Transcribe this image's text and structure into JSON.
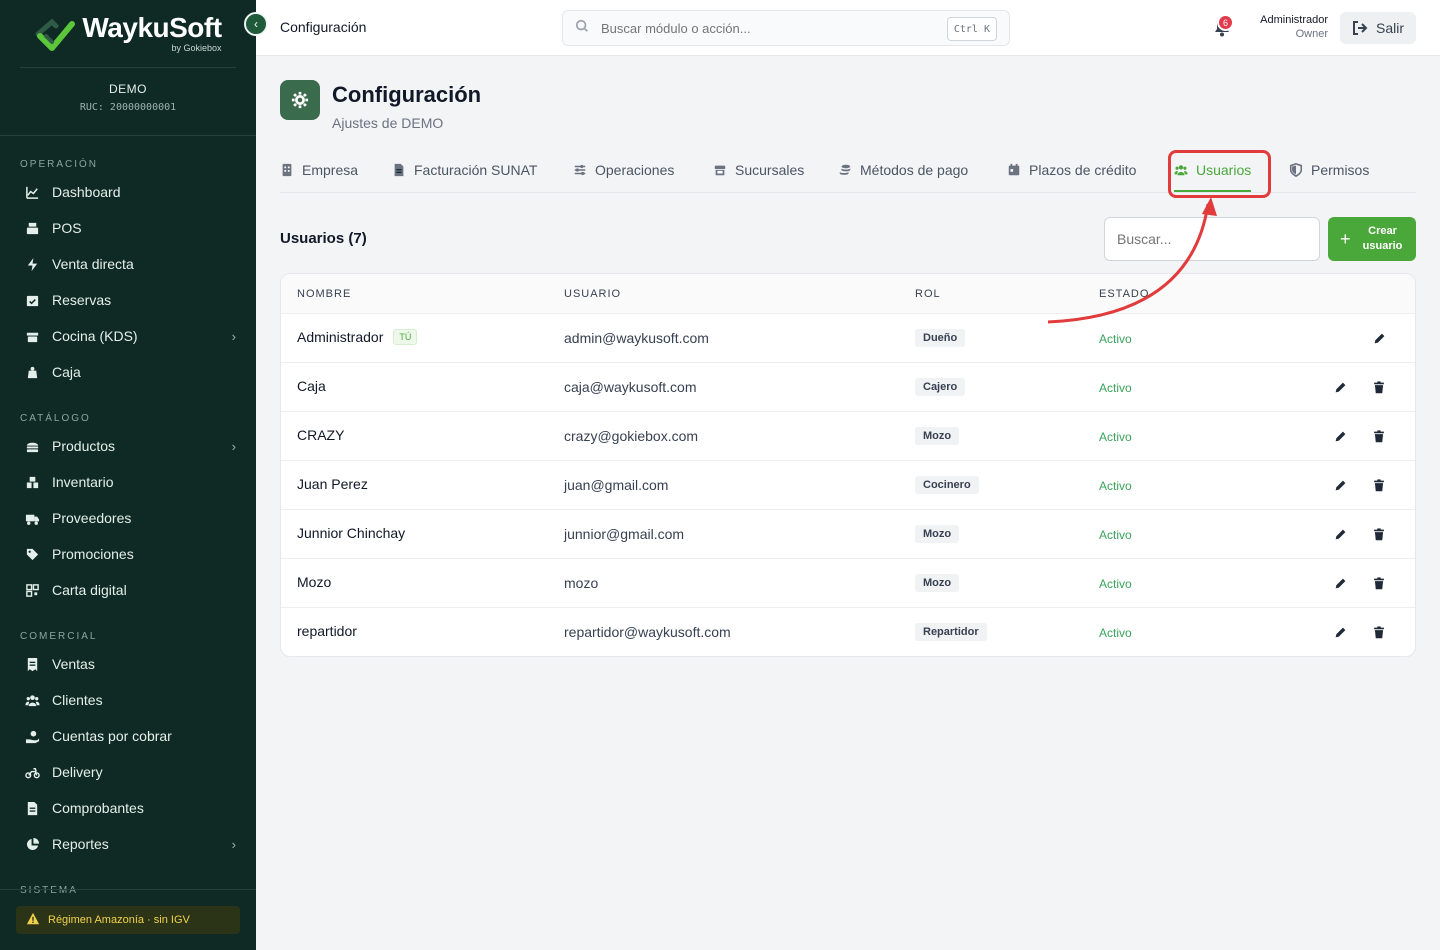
{
  "brand": {
    "name": "WaykuSoft",
    "byline": "by Gokiebox",
    "accent": "#4aa73a"
  },
  "tenant": {
    "name": "DEMO",
    "ruc": "RUC: 20000000001"
  },
  "sidebar": {
    "sections": [
      {
        "title": "OPERACIÓN",
        "items": [
          {
            "label": "Dashboard",
            "icon": "chart-line-icon"
          },
          {
            "label": "POS",
            "icon": "cash-register-icon"
          },
          {
            "label": "Venta directa",
            "icon": "bolt-icon"
          },
          {
            "label": "Reservas",
            "icon": "calendar-check-icon"
          },
          {
            "label": "Cocina (KDS)",
            "icon": "kitchen-icon",
            "has_submenu": true
          },
          {
            "label": "Caja",
            "icon": "cash-icon"
          }
        ]
      },
      {
        "title": "CATÁLOGO",
        "items": [
          {
            "label": "Productos",
            "icon": "burger-icon",
            "has_submenu": true
          },
          {
            "label": "Inventario",
            "icon": "boxes-icon"
          },
          {
            "label": "Proveedores",
            "icon": "truck-icon"
          },
          {
            "label": "Promociones",
            "icon": "tags-icon"
          },
          {
            "label": "Carta digital",
            "icon": "qrcode-icon"
          }
        ]
      },
      {
        "title": "COMERCIAL",
        "items": [
          {
            "label": "Ventas",
            "icon": "receipt-icon"
          },
          {
            "label": "Clientes",
            "icon": "users-icon"
          },
          {
            "label": "Cuentas por cobrar",
            "icon": "hand-dollar-icon"
          },
          {
            "label": "Delivery",
            "icon": "motorcycle-icon"
          },
          {
            "label": "Comprobantes",
            "icon": "file-invoice-icon"
          },
          {
            "label": "Reportes",
            "icon": "pie-chart-icon",
            "has_submenu": true
          }
        ]
      },
      {
        "title": "SISTEMA",
        "items": []
      }
    ],
    "regimen": "Régimen Amazonía · sin IGV"
  },
  "header": {
    "breadcrumb": "Configuración",
    "search_placeholder": "Buscar módulo o acción...",
    "shortcut": "Ctrl K",
    "notifications": "6",
    "user_name": "Administrador",
    "user_role": "Owner",
    "logout": "Salir"
  },
  "page": {
    "title": "Configuración",
    "subtitle": "Ajustes de DEMO",
    "tabs": [
      {
        "label": "Empresa",
        "icon": "building-icon"
      },
      {
        "label": "Facturación SUNAT",
        "icon": "file-invoice-icon"
      },
      {
        "label": "Operaciones",
        "icon": "sliders-icon"
      },
      {
        "label": "Sucursales",
        "icon": "store-icon"
      },
      {
        "label": "Métodos de pago",
        "icon": "coins-icon"
      },
      {
        "label": "Plazos de crédito",
        "icon": "calendar-icon"
      },
      {
        "label": "Usuarios",
        "icon": "users-icon",
        "active": true
      },
      {
        "label": "Permisos",
        "icon": "shield-icon"
      }
    ]
  },
  "users": {
    "heading": "Usuarios (7)",
    "search_placeholder": "Buscar...",
    "create_label": "Crear usuario",
    "columns": [
      "NOMBRE",
      "USUARIO",
      "ROL",
      "ESTADO"
    ],
    "rows": [
      {
        "name": "Administrador",
        "badge": "TÚ",
        "user": "admin@waykusoft.com",
        "role": "Dueño",
        "status": "Activo",
        "deletable": false
      },
      {
        "name": "Caja",
        "user": "caja@waykusoft.com",
        "role": "Cajero",
        "status": "Activo",
        "deletable": true
      },
      {
        "name": "CRAZY",
        "user": "crazy@gokiebox.com",
        "role": "Mozo",
        "status": "Activo",
        "deletable": true
      },
      {
        "name": "Juan Perez",
        "user": "juan@gmail.com",
        "role": "Cocinero",
        "status": "Activo",
        "deletable": true
      },
      {
        "name": "Junnior Chinchay",
        "user": "junnior@gmail.com",
        "role": "Mozo",
        "status": "Activo",
        "deletable": true
      },
      {
        "name": "Mozo",
        "user": "mozo",
        "role": "Mozo",
        "status": "Activo",
        "deletable": true
      },
      {
        "name": "repartidor",
        "user": "repartidor@waykusoft.com",
        "role": "Repartidor",
        "status": "Activo",
        "deletable": true
      }
    ]
  }
}
